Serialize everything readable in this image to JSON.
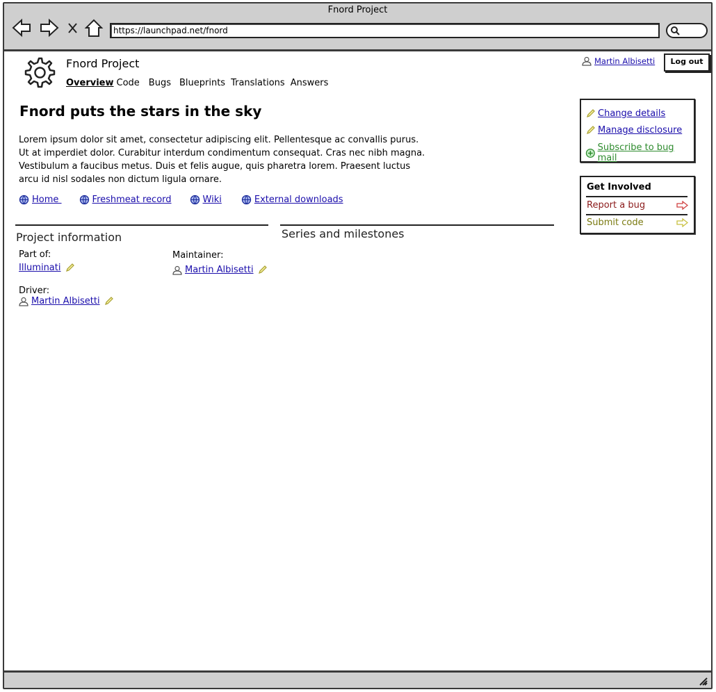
{
  "browser": {
    "window_title": "Fnord Project",
    "url": "https://launchpad.net/fnord"
  },
  "header": {
    "project_name": "Fnord Project",
    "tabs": [
      "Overview",
      "Code",
      "Bugs",
      "Blueprints",
      "Translations",
      "Answers"
    ],
    "active_tab": "Overview",
    "user_name": "Martin Albisetti",
    "logout_label": "Log out"
  },
  "main": {
    "headline": "Fnord puts the stars in the sky",
    "description": "Lorem ipsum dolor sit amet, consectetur adipiscing elit. Pellentesque ac convallis purus. Ut at imperdiet dolor. Curabitur interdum condimentum consequat. Cras nec nibh magna. Vestibulum a faucibus metus. Duis et felis augue, quis pharetra lorem. Praesent luctus arcu id nisl sodales non dictum ligula ornare.",
    "links": [
      {
        "label": "Home ",
        "icon": "globe-icon"
      },
      {
        "label": "Freshmeat record",
        "icon": "globe-icon"
      },
      {
        "label": "Wiki",
        "icon": "globe-icon"
      },
      {
        "label": "External downloads",
        "icon": "globe-icon"
      }
    ]
  },
  "project_info": {
    "title": "Project information",
    "part_of_label": "Part of:",
    "part_of_value": "Illuminati",
    "maintainer_label": "Maintainer:",
    "maintainer_value": "Martin Albisetti",
    "driver_label": "Driver:",
    "driver_value": "Martin Albisetti"
  },
  "series": {
    "title": "Series and milestones"
  },
  "sidebar": {
    "actions": [
      {
        "label": "Change details",
        "icon": "pencil-icon"
      },
      {
        "label": "Manage disclosure",
        "icon": "pencil-icon"
      },
      {
        "label": "Subscribe to bug mail",
        "icon": "plus-circle-icon"
      }
    ],
    "get_involved": {
      "title": "Get Involved",
      "report_bug": "Report a bug",
      "submit_code": "Submit code"
    }
  },
  "colors": {
    "link": "#1a0dab",
    "subscribe": "#2e8b2e",
    "report_bug": "#8b1a1a",
    "submit_code": "#7a7a10",
    "chrome": "#cfcfcf"
  }
}
